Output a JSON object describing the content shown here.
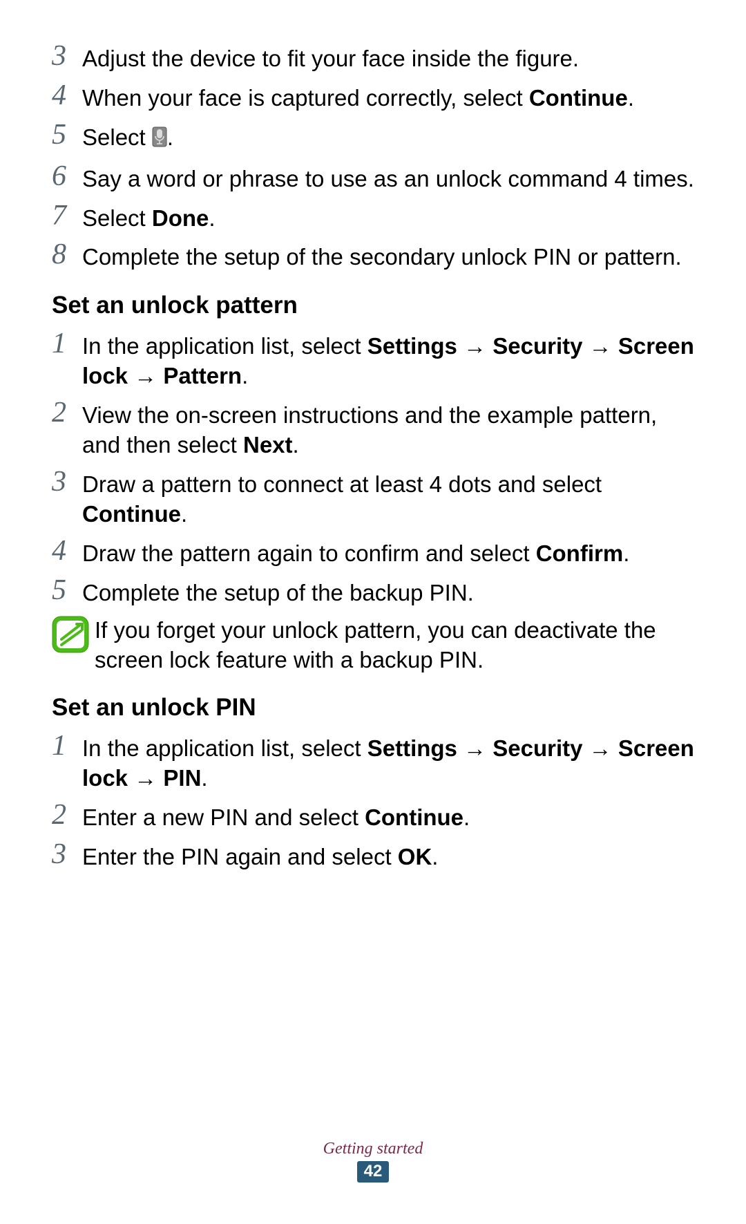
{
  "steps_a": [
    {
      "num": "3",
      "segments": [
        {
          "t": "Adjust the device to fit your face inside the figure."
        }
      ]
    },
    {
      "num": "4",
      "segments": [
        {
          "t": "When your face is captured correctly, select "
        },
        {
          "t": "Continue",
          "b": true
        },
        {
          "t": "."
        }
      ]
    },
    {
      "num": "5",
      "segments": [
        {
          "t": "Select "
        },
        {
          "icon": "mic"
        },
        {
          "t": "."
        }
      ]
    },
    {
      "num": "6",
      "segments": [
        {
          "t": "Say a word or phrase to use as an unlock command 4 times."
        }
      ]
    },
    {
      "num": "7",
      "segments": [
        {
          "t": "Select "
        },
        {
          "t": "Done",
          "b": true
        },
        {
          "t": "."
        }
      ]
    },
    {
      "num": "8",
      "segments": [
        {
          "t": "Complete the setup of the secondary unlock PIN or pattern."
        }
      ]
    }
  ],
  "heading_pattern": "Set an unlock pattern",
  "steps_pattern": [
    {
      "num": "1",
      "segments": [
        {
          "t": "In the application list, select "
        },
        {
          "t": "Settings",
          "b": true
        },
        {
          "t": " → ",
          "b": true
        },
        {
          "t": "Security",
          "b": true
        },
        {
          "t": " → ",
          "b": true
        },
        {
          "t": "Screen lock",
          "b": true
        },
        {
          "t": " → ",
          "b": true
        },
        {
          "t": "Pattern",
          "b": true
        },
        {
          "t": "."
        }
      ]
    },
    {
      "num": "2",
      "segments": [
        {
          "t": "View the on-screen instructions and the example pattern, and then select "
        },
        {
          "t": "Next",
          "b": true
        },
        {
          "t": "."
        }
      ]
    },
    {
      "num": "3",
      "segments": [
        {
          "t": "Draw a pattern to connect at least 4 dots and select "
        },
        {
          "t": "Continue",
          "b": true
        },
        {
          "t": "."
        }
      ]
    },
    {
      "num": "4",
      "segments": [
        {
          "t": "Draw the pattern again to confirm and select "
        },
        {
          "t": "Confirm",
          "b": true
        },
        {
          "t": "."
        }
      ]
    },
    {
      "num": "5",
      "segments": [
        {
          "t": "Complete the setup of the backup PIN."
        }
      ]
    }
  ],
  "note_pattern": "If you forget your unlock pattern, you can deactivate the screen lock feature with a backup PIN.",
  "heading_pin": "Set an unlock PIN",
  "steps_pin": [
    {
      "num": "1",
      "segments": [
        {
          "t": "In the application list, select "
        },
        {
          "t": "Settings",
          "b": true
        },
        {
          "t": " → ",
          "b": true
        },
        {
          "t": "Security",
          "b": true
        },
        {
          "t": " → ",
          "b": true
        },
        {
          "t": "Screen lock",
          "b": true
        },
        {
          "t": " → ",
          "b": true
        },
        {
          "t": "PIN",
          "b": true
        },
        {
          "t": "."
        }
      ]
    },
    {
      "num": "2",
      "segments": [
        {
          "t": "Enter a new PIN and select "
        },
        {
          "t": "Continue",
          "b": true
        },
        {
          "t": "."
        }
      ]
    },
    {
      "num": "3",
      "segments": [
        {
          "t": "Enter the PIN again and select "
        },
        {
          "t": "OK",
          "b": true
        },
        {
          "t": "."
        }
      ]
    }
  ],
  "footer_label": "Getting started",
  "page_number": "42"
}
